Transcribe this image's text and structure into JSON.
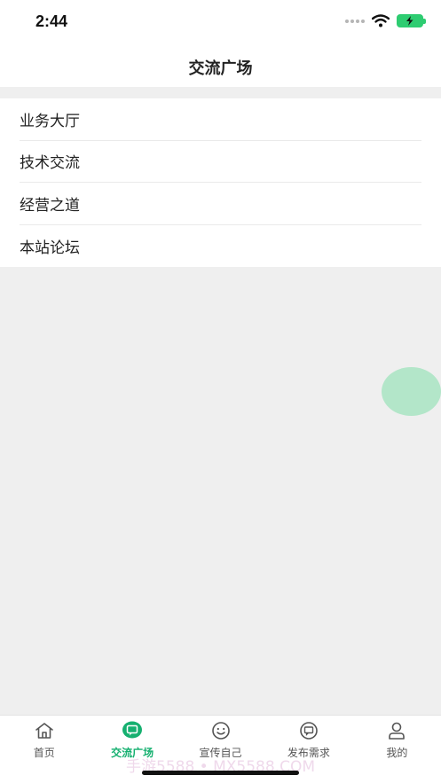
{
  "status_bar": {
    "time": "2:44"
  },
  "header": {
    "title": "交流广场"
  },
  "menu": {
    "items": [
      {
        "label": "业务大厅"
      },
      {
        "label": "技术交流"
      },
      {
        "label": "经营之道"
      },
      {
        "label": "本站论坛"
      }
    ]
  },
  "tabbar": {
    "items": [
      {
        "label": "首页",
        "icon": "home-icon"
      },
      {
        "label": "交流广场",
        "icon": "chat-bubble-icon",
        "active": true
      },
      {
        "label": "宣传自己",
        "icon": "smiley-icon"
      },
      {
        "label": "发布需求",
        "icon": "message-icon"
      },
      {
        "label": "我的",
        "icon": "user-icon"
      }
    ]
  },
  "watermark": "手游5588 • MX5588.COM",
  "colors": {
    "accent": "#16b070",
    "bubble": "#b3e6c9",
    "battery": "#2ecc71"
  }
}
